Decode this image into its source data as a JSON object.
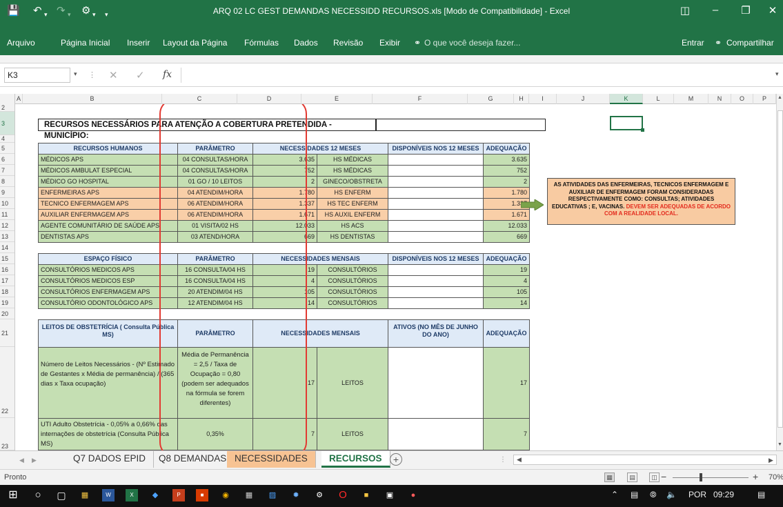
{
  "window": {
    "title": "ARQ 02 LC GEST DEMANDAS NECESSIDD RECURSOS.xls  [Modo de Compatibilidade]  -  Excel",
    "icon": "save-icon"
  },
  "ribbon": {
    "tabs": [
      "Arquivo",
      "Página Inicial",
      "Inserir",
      "Layout da Página",
      "Fórmulas",
      "Dados",
      "Revisão",
      "Exibir"
    ],
    "tell_me": "O que você deseja fazer...",
    "sign_in": "Entrar",
    "share": "Compartilhar"
  },
  "formula_bar": {
    "name_box": "K3",
    "fx": "fx",
    "value": ""
  },
  "columns": [
    "A",
    "B",
    "C",
    "D",
    "E",
    "F",
    "G",
    "H",
    "I",
    "J",
    "K",
    "L",
    "M",
    "N",
    "O",
    "P"
  ],
  "rows": [
    "2",
    "3",
    "4",
    "5",
    "6",
    "7",
    "8",
    "9",
    "10",
    "11",
    "12",
    "13",
    "14",
    "15",
    "16",
    "17",
    "18",
    "19",
    "20",
    "21",
    "22",
    "23"
  ],
  "sheet": {
    "title": "RECURSOS NECESSÁRIOS PARA ATENÇÃO A COBERTURA PRETENDIDA - MUNICÍPIO:",
    "headers_rh": [
      "RECURSOS HUMANOS",
      "PARÂMETRO",
      "NECESSIDADES 12 MESES",
      "DISPONÍVEIS NOS 12 MESES",
      "ADEQUAÇÃO"
    ],
    "rh_rows": [
      {
        "name": "MÉDICOS APS",
        "param": "04 CONSULTAS/HORA",
        "value": "3.635",
        "unit": "HS MÉDICAS",
        "adequacao": "3.635"
      },
      {
        "name": "MÉDICOS AMBULAT ESPECIAL",
        "param": "04 CONSULTAS/HORA",
        "value": "752",
        "unit": "HS MÉDICAS",
        "adequacao": "752"
      },
      {
        "name": "MÉDICO GO HOSPITAL",
        "param": "01 GO / 10 LEITOS",
        "value": "2",
        "unit": "GINECO/OBSTRETA",
        "adequacao": "2"
      },
      {
        "name": "ENFERMEIRAS APS",
        "param": "04 ATENDIM/HORA",
        "value": "1.780",
        "unit": "HS ENFERM",
        "adequacao": "1.780"
      },
      {
        "name": "TECNICO ENFERMAGEM APS",
        "param": "06 ATENDIM/HORA",
        "value": "1.337",
        "unit": "HS TEC ENFERM",
        "adequacao": "1.337"
      },
      {
        "name": "AUXILIAR ENFERMAGEM APS",
        "param": "06 ATENDIM/HORA",
        "value": "1.671",
        "unit": "HS AUXIL ENFERM",
        "adequacao": "1.671"
      },
      {
        "name": "AGENTE COMUNITÁRIO DE SAÚDE APS",
        "param": "01 VISITA/02 HS",
        "value": "12.033",
        "unit": "HS ACS",
        "adequacao": "12.033"
      },
      {
        "name": "DENTISTAS APS",
        "param": "03 ATEND/HORA",
        "value": "669",
        "unit": "HS DENTISTAS",
        "adequacao": "669"
      }
    ],
    "headers_ef": [
      "ESPAÇO FÍSICO",
      "PARÂMETRO",
      "NECESSIDADES MENSAIS",
      "DISPONÍVEIS NOS 12 MESES",
      "ADEQUAÇÃO"
    ],
    "ef_rows": [
      {
        "name": "CONSULTÓRIOS MEDICOS APS",
        "param": "16 CONSULTA/04 HS",
        "value": "19",
        "unit": "CONSULTÓRIOS",
        "adequacao": "19"
      },
      {
        "name": "CONSULTÓRIOS MEDICOS ESP",
        "param": "16 CONSULTA/04 HS",
        "value": "4",
        "unit": "CONSULTÓRIOS",
        "adequacao": "4"
      },
      {
        "name": "CONSULTÓRIOS ENFERMAGEM APS",
        "param": "20 ATENDIM/04 HS",
        "value": "105",
        "unit": "CONSULTÓRIOS",
        "adequacao": "105"
      },
      {
        "name": "CONSULTÓRIO ODONTOLÓGICO APS",
        "param": "12 ATENDIM/04 HS",
        "value": "14",
        "unit": "CONSULTÓRIOS",
        "adequacao": "14"
      }
    ],
    "headers_lo": [
      "LEITOS DE OBSTETRÍCIA ( Consulta Pública MS)",
      "PARÂMETRO",
      "NECESSIDADES MENSAIS",
      "ATIVOS (NO MÊS DE JUNHO DO ANO)",
      "ADEQUAÇÃO"
    ],
    "lo_rows": [
      {
        "name": "Número de Leitos Necessários - (Nº Estimado de Gestantes  x Média de permanência) / (365 dias x Taxa ocupação)",
        "param": "Média de Permanência = 2,5   /   Taxa de Ocupação = 0,80 (podem ser adequados na fórmula se forem diferentes)",
        "value": "17",
        "unit": "LEITOS",
        "adequacao": "17"
      },
      {
        "name": "UTI Adulto Obstetrícia - 0,05% a 0,66% das internações de obstetrícia (Consulta Pública MS)",
        "param": "0,35%",
        "value": "7",
        "unit": "LEITOS",
        "adequacao": "7"
      }
    ],
    "note_text": "AS ATIVIDADES DAS ENFERMEIRAS, TECNICOS ENFERMAGEM E AUXILIAR DE ENFERMAGEM FORAM CONSIDERADAS RESPECTIVAMENTE COMO: CONSULTAS; ATIVIDADES EDUCATIVAS ; E, VACINAS.",
    "note_red": "DEVEM SER ADEQUADAS DE ACORDO COM A REALIDADE LOCAL."
  },
  "sheet_tabs": [
    "Q7 DADOS EPID",
    "Q8 DEMANDAS",
    "NECESSIDADES",
    "RECURSOS"
  ],
  "status": {
    "text": "Pronto",
    "zoom": "70%"
  },
  "taskbar": {
    "lang": "POR",
    "time": "09:29"
  },
  "colors": {
    "excel_green": "#217346",
    "cell_green": "#c5dfb3",
    "cell_blue": "#dfeaf7",
    "cell_orange": "#f9cfa8",
    "annotation_red": "#e23a32"
  }
}
